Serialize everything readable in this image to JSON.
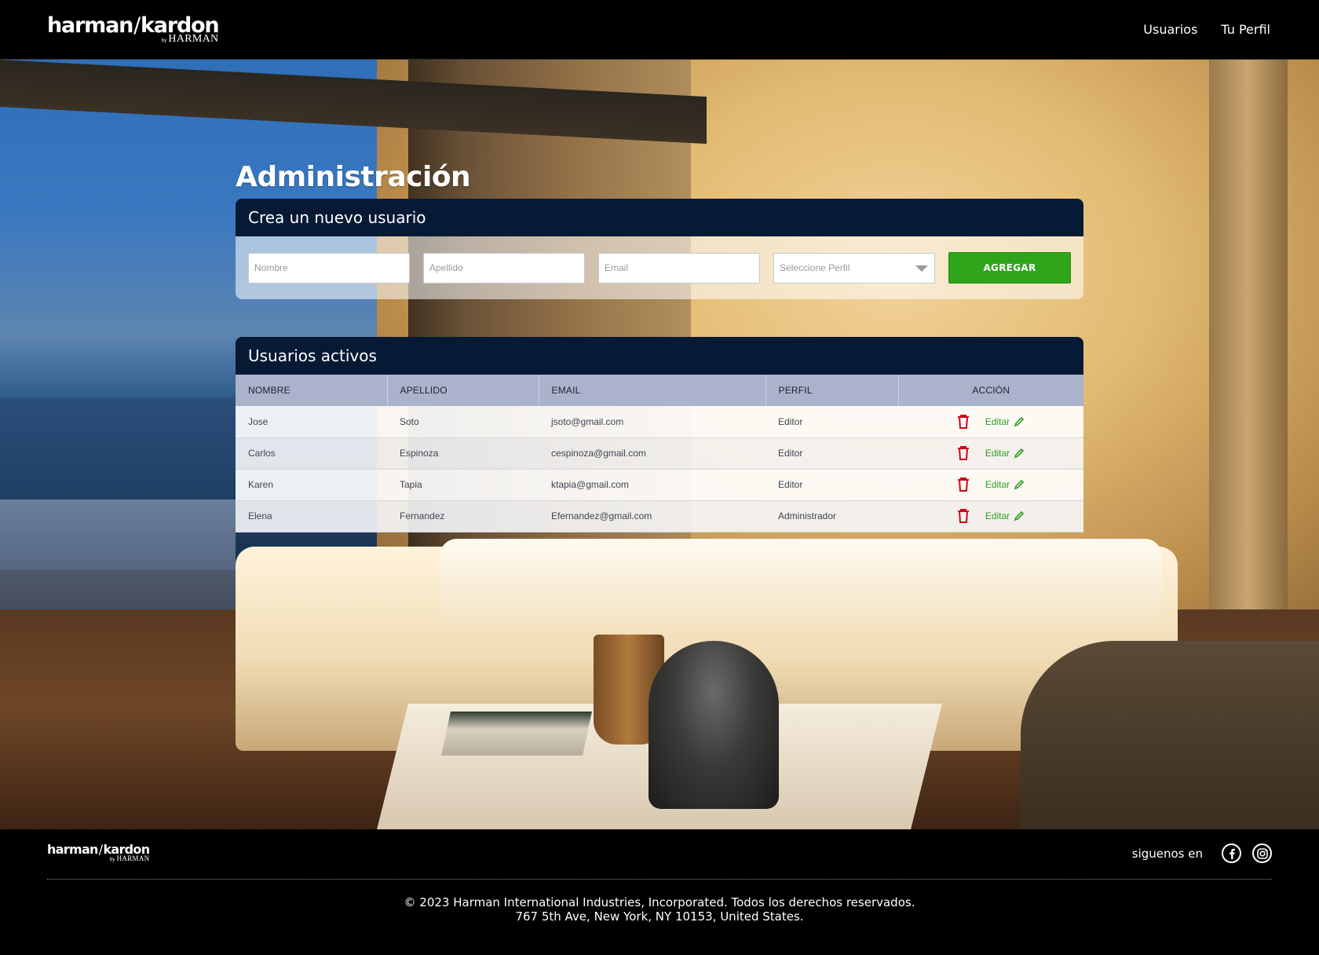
{
  "brand": {
    "logo_main_left": "harman",
    "logo_main_right": "kardon",
    "logo_by": "by",
    "logo_sub": "HARMAN"
  },
  "nav": {
    "items": [
      "Usuarios",
      "Tu Perfil"
    ]
  },
  "page": {
    "title": "Administración"
  },
  "create_user": {
    "heading": "Crea un nuevo usuario",
    "first_name_placeholder": "Nombre",
    "last_name_placeholder": "Apellido",
    "email_placeholder": "Email",
    "profile_placeholder": "Seleccione Perfil",
    "submit_label": "AGREGAR",
    "submit_color": "#2fa51b"
  },
  "active_users": {
    "heading": "Usuarios  activos",
    "columns": [
      "NOMBRE",
      "APELLIDO",
      "EMAIL",
      "PERFIL",
      "ACCIÓN"
    ],
    "edit_label": "Editar",
    "rows": [
      {
        "first": "Jose",
        "last": "Soto",
        "email": "jsoto@gmail.com",
        "profile": "Editor"
      },
      {
        "first": "Carlos",
        "last": "Espinoza",
        "email": "cespinoza@gmail.com",
        "profile": "Editor"
      },
      {
        "first": "Karen",
        "last": "Tapia",
        "email": "ktapia@gmail.com",
        "profile": "Editor"
      },
      {
        "first": "Elena",
        "last": "Fernandez",
        "email": "Efernandez@gmail.com",
        "profile": "Administrador"
      }
    ],
    "delete_icon_color": "#d0021b",
    "edit_color": "#2f9e24"
  },
  "footer": {
    "follow_label": "siguenos en",
    "social": [
      "facebook-icon",
      "instagram-icon"
    ],
    "copyright_line1": "© 2023 Harman International Industries, Incorporated. Todos los derechos reservados.",
    "copyright_line2": "767 5th Ave, New York, NY 10153, United States."
  },
  "colors": {
    "header_bg": "#000000",
    "card_head_bg": "#061a35",
    "table_head_bg": "#aab2cc"
  }
}
